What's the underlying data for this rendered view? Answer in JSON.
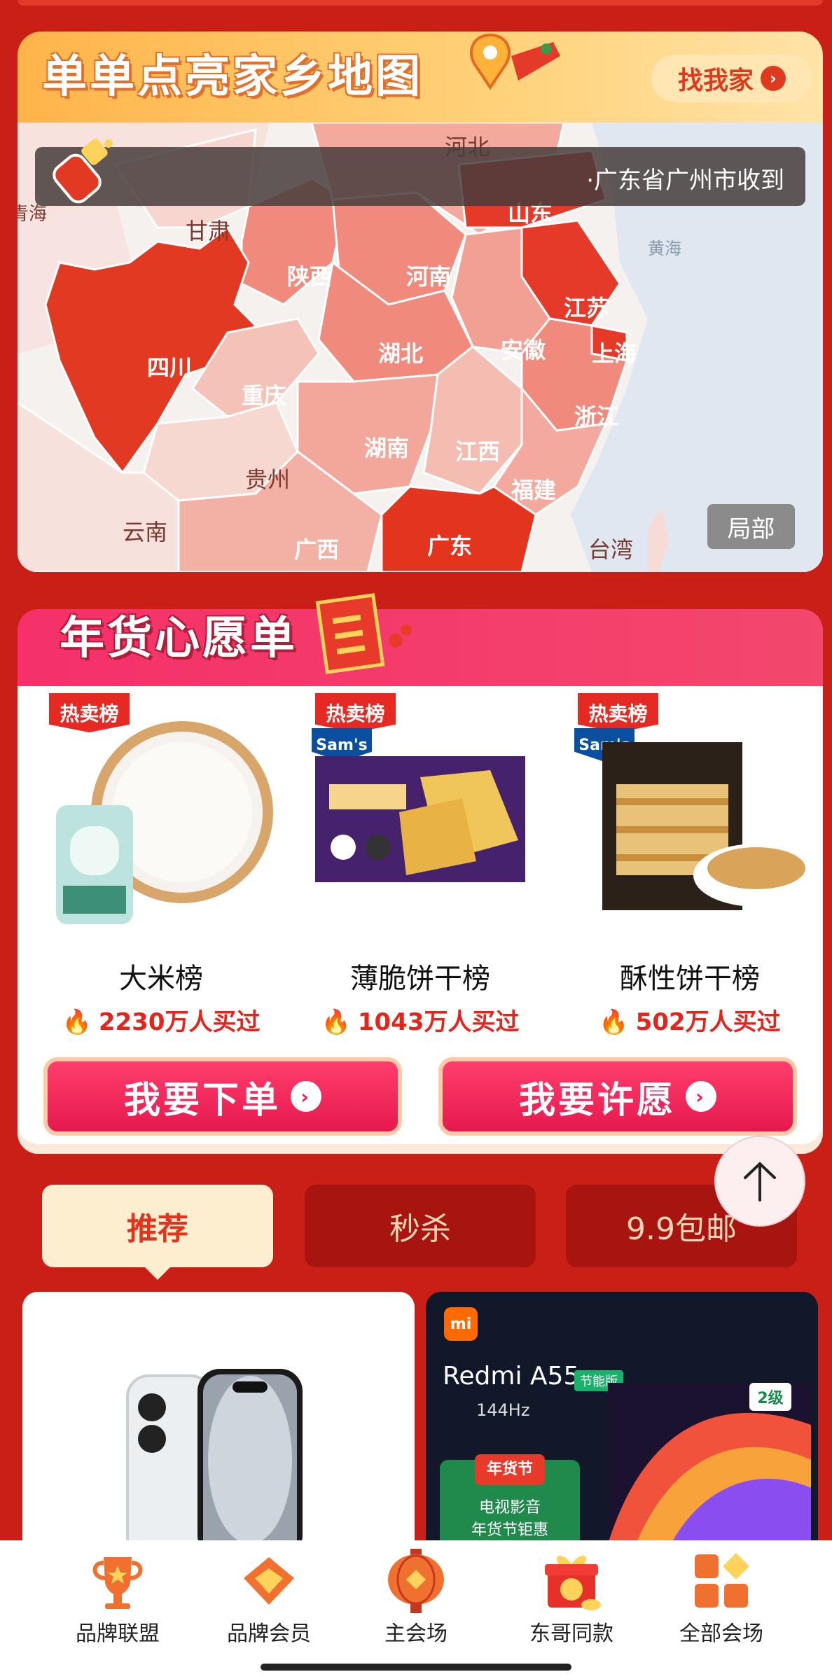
{
  "map": {
    "title": "单单点亮家乡地图",
    "find_home_label": "找我家",
    "ticker_text": "·广东省广州市收到",
    "local_button": "局部",
    "provinces": {
      "hebei": "河北",
      "shandong": "山东",
      "qinghai": "青海",
      "gansu": "甘肃",
      "shaanxi": "陕西",
      "henan": "河南",
      "jiangsu": "江苏",
      "sichuan": "四川",
      "hubei": "湖北",
      "anhui": "安徽",
      "shanghai": "上海",
      "chongqing": "重庆",
      "zhejiang": "浙江",
      "hunan": "湖南",
      "jiangxi": "江西",
      "guizhou": "贵州",
      "fujian": "福建",
      "yunnan": "云南",
      "guangxi": "广西",
      "guangdong": "广东",
      "taiwan": "台湾",
      "yellow_sea": "黄海"
    }
  },
  "wishlist": {
    "title": "年货心愿单",
    "badge": "热卖榜",
    "sams_label": "Sam's",
    "products": [
      {
        "name": "大米榜",
        "sales": "2230万人买过"
      },
      {
        "name": "薄脆饼干榜",
        "sales": "1043万人买过"
      },
      {
        "name": "酥性饼干榜",
        "sales": "502万人买过"
      }
    ],
    "order_button": "我要下单",
    "wish_button": "我要许愿"
  },
  "tabs": [
    {
      "label": "推荐",
      "active": true
    },
    {
      "label": "秒杀",
      "active": false
    },
    {
      "label": "9.9包邮",
      "active": false
    }
  ],
  "feed": {
    "tv": {
      "brand": "mi",
      "title": "Redmi A55",
      "tag": "节能版",
      "sub": "144Hz",
      "promo_head": "年货节",
      "promo_line1": "电视影音",
      "promo_line2": "年货节钜惠",
      "eco": "2级"
    }
  },
  "bottom_nav": [
    {
      "label": "品牌联盟",
      "icon": "trophy-icon"
    },
    {
      "label": "品牌会员",
      "icon": "diamond-icon"
    },
    {
      "label": "主会场",
      "icon": "lantern-icon"
    },
    {
      "label": "东哥同款",
      "icon": "gift-icon"
    },
    {
      "label": "全部会场",
      "icon": "grid-icon"
    }
  ],
  "colors": {
    "background": "#c91f17",
    "accent": "#e2261e",
    "pink": "#f3476d",
    "map_header": "#ffb44a"
  }
}
